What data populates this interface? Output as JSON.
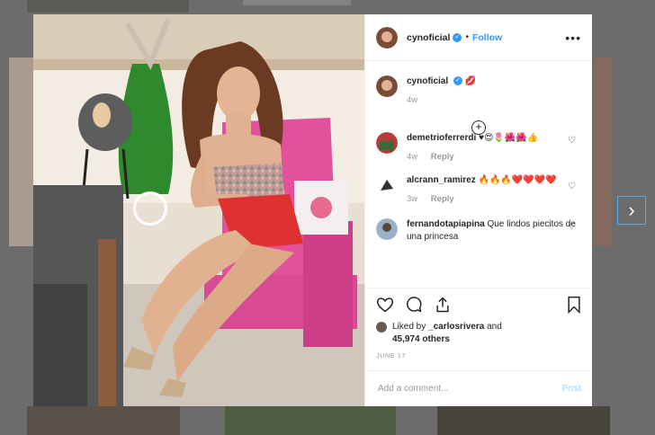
{
  "post": {
    "username": "cynoficial",
    "follow_label": "Follow",
    "more_label": "•••",
    "caption_emoji": "💋",
    "caption_time": "4w",
    "colors": {
      "accent": "#3897f0",
      "post_disabled": "#b2dffc"
    }
  },
  "comments": [
    {
      "username": "demetrioferrerdi",
      "text": "♥😍🌷🌺🌺👍",
      "time": "4w",
      "reply": "Reply"
    },
    {
      "username": "alcrann_ramirez",
      "text": "🔥🔥🔥❤️❤️❤️❤️",
      "time": "3w",
      "reply": "Reply"
    },
    {
      "username": "fernandotapiapina",
      "text": "Que lindos piecitos de una princesa"
    }
  ],
  "likes": {
    "prefix": "Liked by",
    "user": "_carlosrivera",
    "suffix": "and",
    "count": "45,974 others"
  },
  "date": "JUNE 17",
  "add_comment": {
    "placeholder": "Add a comment...",
    "post_label": "Post"
  },
  "icons": [
    "heart-icon",
    "comment-icon",
    "share-icon",
    "bookmark-icon",
    "verified-badge-icon",
    "next-arrow-icon",
    "add-circle-icon"
  ]
}
